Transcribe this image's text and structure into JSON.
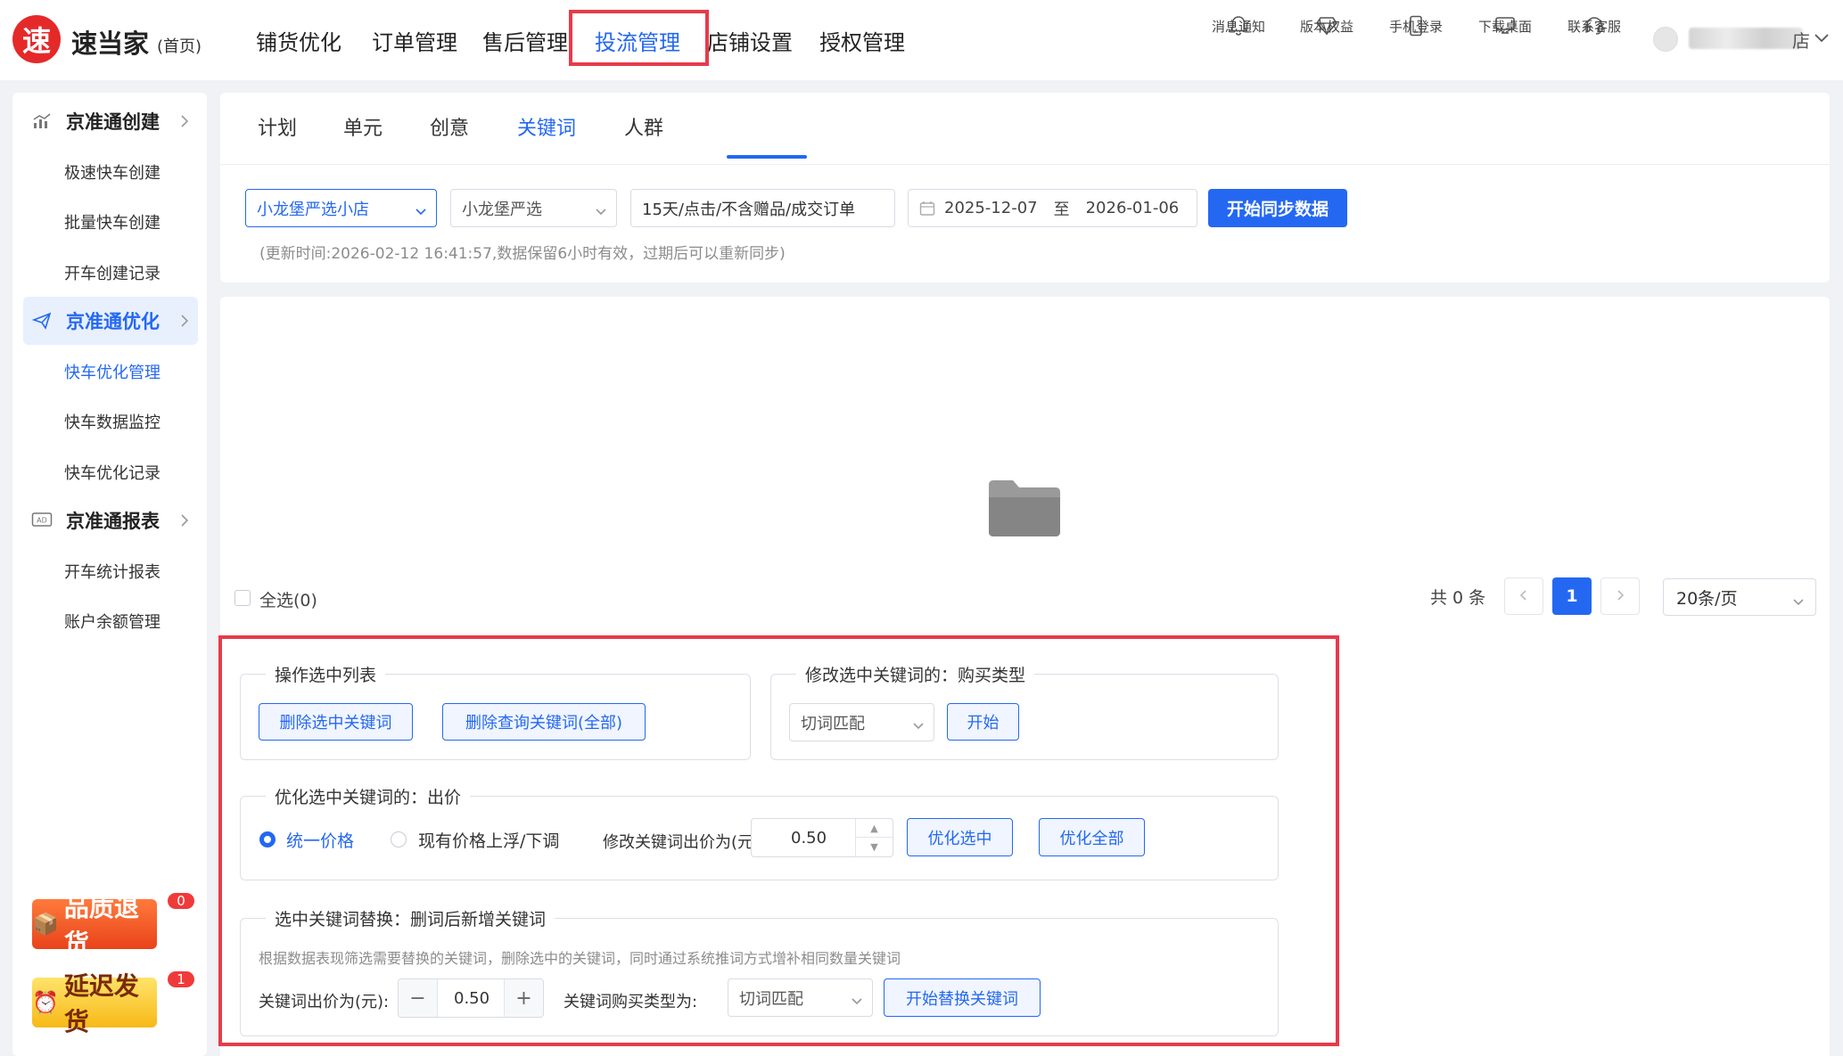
{
  "header": {
    "logo_char": "速",
    "logo_text": "速当家",
    "logo_sub": "(首页)",
    "nav": [
      {
        "label": "铺货优化"
      },
      {
        "label": "订单管理"
      },
      {
        "label": "售后管理"
      },
      {
        "label": "投流管理",
        "active": true
      },
      {
        "label": "店铺设置"
      },
      {
        "label": "授权管理"
      }
    ],
    "tools": [
      {
        "label": "消息通知",
        "icon": "bell-icon"
      },
      {
        "label": "版本权益",
        "icon": "diamond-icon"
      },
      {
        "label": "手机登录",
        "icon": "mobile-icon"
      },
      {
        "label": "下载桌面",
        "icon": "monitor-icon"
      },
      {
        "label": "联系客服",
        "icon": "headset-icon"
      }
    ],
    "user_suffix": "店"
  },
  "sidebar": {
    "groups": [
      {
        "label": "京准通创建",
        "icon": "chart-icon",
        "items": [
          "极速快车创建",
          "批量快车创建",
          "开车创建记录"
        ]
      },
      {
        "label": "京准通优化",
        "icon": "send-icon",
        "active": true,
        "items": [
          "快车优化管理",
          "快车数据监控",
          "快车优化记录"
        ],
        "active_item": 0
      },
      {
        "label": "京准通报表",
        "icon": "ad-icon",
        "items": [
          "开车统计报表",
          "账户余额管理"
        ]
      }
    ],
    "promos": [
      {
        "label": "品质退货",
        "badge": "0",
        "icon": "box-icon"
      },
      {
        "label": "延迟发货",
        "badge": "1",
        "icon": "clock-icon"
      }
    ]
  },
  "tabs": [
    {
      "label": "计划"
    },
    {
      "label": "单元"
    },
    {
      "label": "创意"
    },
    {
      "label": "关键词",
      "active": true
    },
    {
      "label": "人群"
    }
  ],
  "filters": {
    "shop": "小龙堡严选小店",
    "sub_shop": "小龙堡严选",
    "metric": "15天/点击/不含赠品/成交订单",
    "date_start": "2025-12-07",
    "date_sep": "至",
    "date_end": "2026-01-06",
    "sync_button": "开始同步数据",
    "update_hint": "(更新时间:2026-02-12 16:41:57,数据保留6小时有效，过期后可以重新同步)"
  },
  "list": {
    "select_all": "全选(0)",
    "total": "共 0 条",
    "current_page": "1",
    "page_size": "20条/页"
  },
  "ops": {
    "section1": {
      "title": "操作选中列表",
      "btn_delete_selected": "删除选中关键词",
      "btn_delete_all": "删除查询关键词(全部)"
    },
    "section2": {
      "title": "修改选中关键词的：购买类型",
      "match_type": "切词匹配",
      "start": "开始"
    },
    "section3": {
      "title": "优化选中关键词的：出价",
      "radio_uniform": "统一价格",
      "radio_float": "现有价格上浮/下调",
      "bid_label": "修改关键词出价为(元):",
      "bid_value": "0.50",
      "btn_opt_selected": "优化选中",
      "btn_opt_all": "优化全部"
    },
    "section4": {
      "title": "选中关键词替换：删词后新增关键词",
      "hint": "根据数据表现筛选需要替换的关键词，删除选中的关键词，同时通过系统推词方式增补相同数量关键词",
      "bid_label": "关键词出价为(元):",
      "bid_value": "0.50",
      "type_label": "关键词购买类型为:",
      "type_value": "切词匹配",
      "btn_replace": "开始替换关键词"
    }
  },
  "colors": {
    "accent": "#2468f2",
    "brand_red": "#e52929",
    "highlight_box": "#e83a4a"
  }
}
